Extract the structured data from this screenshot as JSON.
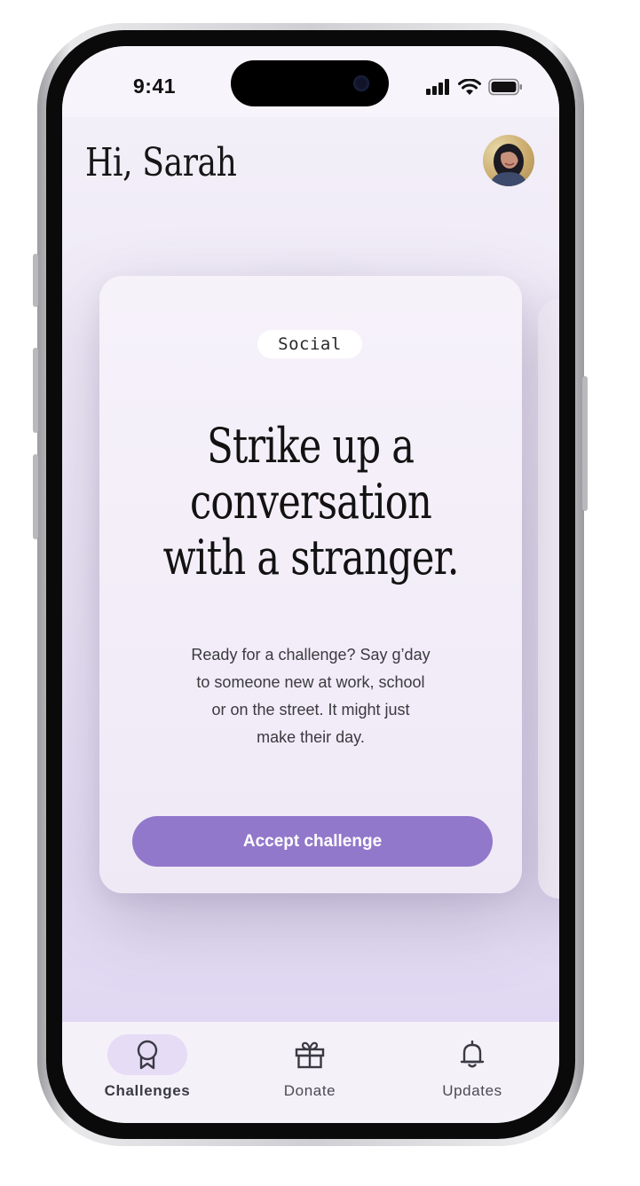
{
  "status_bar": {
    "time": "9:41"
  },
  "header": {
    "greeting": "Hi, Sarah"
  },
  "card": {
    "category": "Social",
    "headline_lines": [
      "Strike up a",
      "conversation",
      "with a stranger."
    ],
    "description_lines": [
      "Ready for a challenge? Say g’day",
      "to someone new at work, school",
      "or on the street. It might just",
      "make their day."
    ],
    "cta_label": "Accept challenge"
  },
  "tab_bar": {
    "tabs": [
      {
        "label": "Challenges",
        "icon": "award-ribbon-icon",
        "active": true
      },
      {
        "label": "Donate",
        "icon": "gift-icon",
        "active": false
      },
      {
        "label": "Updates",
        "icon": "bell-icon",
        "active": false
      }
    ]
  },
  "colors": {
    "accent": "#9278cb",
    "tab_active_bg": "#e6dcf5",
    "background": "#ede7f6"
  }
}
